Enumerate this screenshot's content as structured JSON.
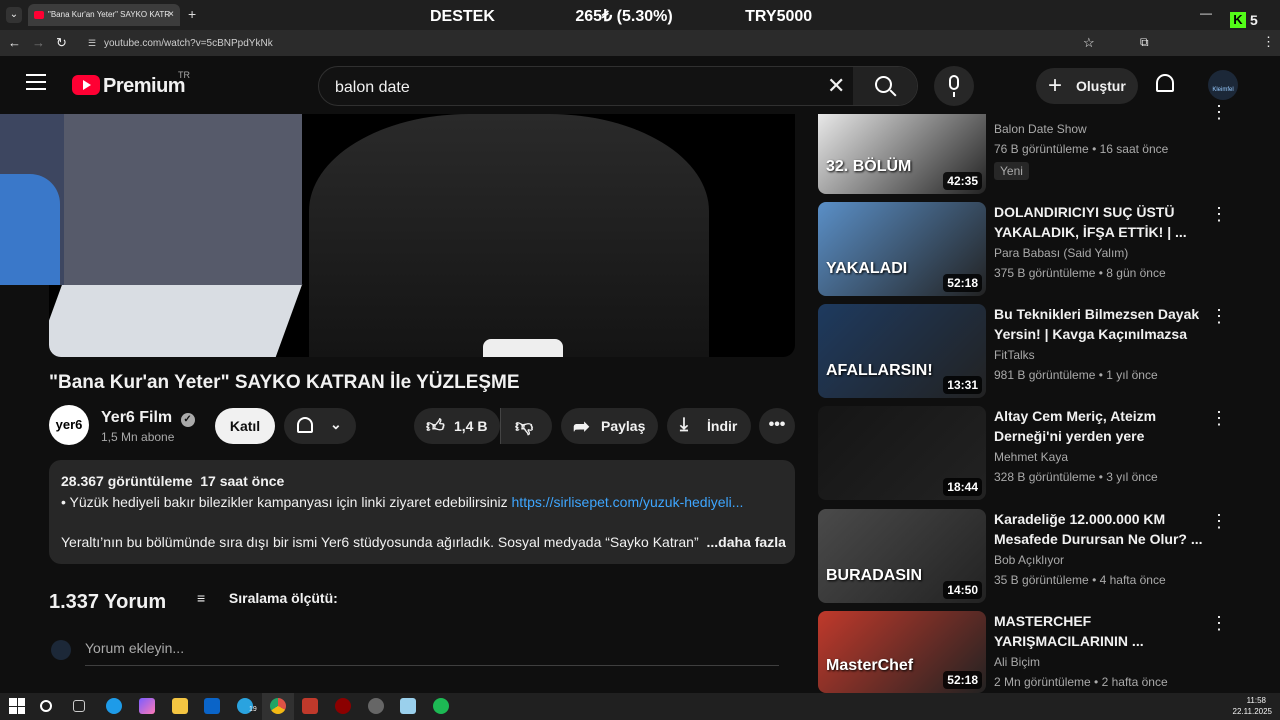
{
  "browser": {
    "tab_title": "\"Bana Kur'an Yeter\" SAYKO KATR",
    "url": "youtube.com/watch?v=5cBNPpdYkNk",
    "overlay": {
      "left": "DESTEK",
      "mid": "265₺ (5.30%)",
      "right": "TRY5000"
    },
    "kick_count": "5"
  },
  "yt": {
    "logo_text": "Premium",
    "region": "TR",
    "search_value": "balon date",
    "create_label": "Oluştur",
    "avatar_label": "Kleimfel"
  },
  "video": {
    "title": "\"Bana Kur'an Yeter\" SAYKO KATRAN İle YÜZLEŞME",
    "channel": "Yer6 Film",
    "channel_logo": "yer6",
    "subscribers": "1,5 Mn abone",
    "join_label": "Katıl",
    "likes": "1,4 B",
    "share_label": "Paylaş",
    "download_label": "İndir"
  },
  "description": {
    "stats": "28.367 görüntüleme  17 saat önce",
    "line1_text": "• Yüzük hediyeli bakır bilezikler kampanyası için linki ziyaret edebilirsiniz",
    "line1_link": "https://sirlisepet.com/yuzuk-hediyeli...",
    "line2": "Yeraltı’nın bu bölümünde sıra dışı bir ismi Yer6 stüdyosunda ağırladık. Sosyal medyada “Sayko Katran”",
    "more": "...daha fazla"
  },
  "comments": {
    "count": "1.337 Yorum",
    "sort_label": "Sıralama ölçütü:",
    "placeholder": "Yorum ekleyin..."
  },
  "recommendations": [
    {
      "title": "",
      "channel": "Balon Date Show",
      "meta": "76 B görüntüleme • 16 saat önce",
      "badge": "Yeni",
      "duration": "42:35",
      "thumb_text": "32. BÖLÜM",
      "color": "#e8e8e8"
    },
    {
      "title": "DOLANDIRICIYI SUÇ ÜSTÜ YAKALADIK, İFŞA ETTİK! | ...",
      "channel": "Para Babası (Said Yalım)",
      "meta": "375 B görüntüleme • 8 gün önce",
      "duration": "52:18",
      "thumb_text": "YAKALADI",
      "color": "#5a8fc7"
    },
    {
      "title": "Bu Teknikleri Bilmezsen Dayak Yersin! | Kavga Kaçınılmazsa B...",
      "channel": "FitTalks",
      "meta": "981 B görüntüleme • 1 yıl önce",
      "duration": "13:31",
      "thumb_text": "AFALLARSIN!",
      "color": "#1e3a5f"
    },
    {
      "title": "Altay Cem Meriç, Ateizm Derneği'ni yerden yere vuruyor!",
      "channel": "Mehmet Kaya",
      "meta": "328 B görüntüleme • 3 yıl önce",
      "duration": "18:44",
      "thumb_text": "",
      "color": "#151515"
    },
    {
      "title": "Karadeliğe 12.000.000 KM Mesafede Durursan Ne Olur? ...",
      "channel": "Bob Açıklıyor",
      "meta": "35 B görüntüleme • 4 hafta önce",
      "duration": "14:50",
      "thumb_text": "BURADASIN",
      "color": "#4a4a4a"
    },
    {
      "title": "MASTERCHEF YARIŞMACILARININ ...",
      "channel": "Ali Biçim",
      "meta": "2 Mn görüntüleme • 2 hafta önce",
      "duration": "52:18",
      "thumb_text": "MasterChef",
      "color": "#c0392b"
    }
  ],
  "taskbar": {
    "time": "11:58",
    "date": "22.11.2025",
    "telegram_badge": "19"
  }
}
